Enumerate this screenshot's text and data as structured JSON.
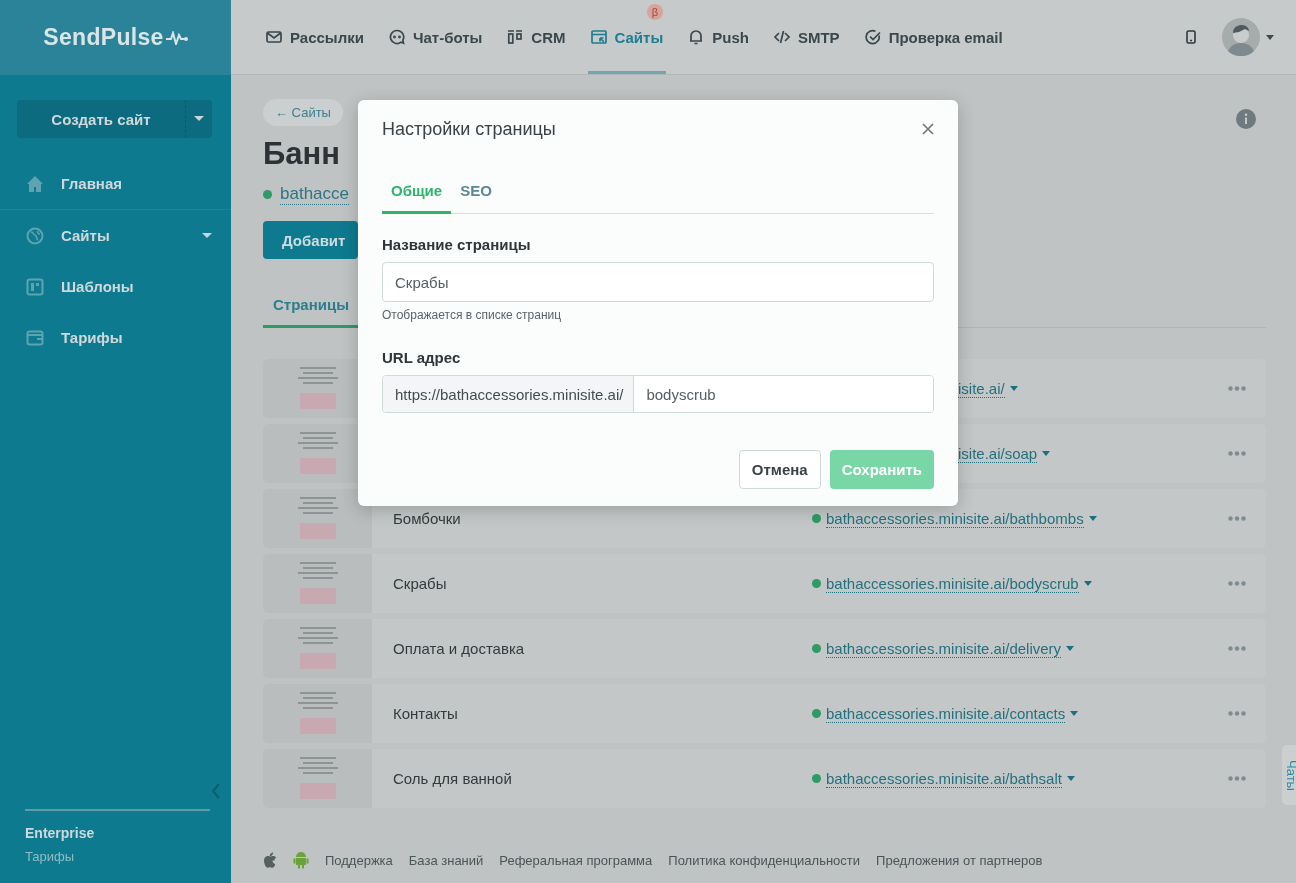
{
  "logo": {
    "text": "SendPulse"
  },
  "nav": [
    {
      "label": "Рассылки",
      "selected": false
    },
    {
      "label": "Чат-боты",
      "selected": false
    },
    {
      "label": "CRM",
      "selected": false
    },
    {
      "label": "Сайты",
      "selected": true,
      "badge": "β"
    },
    {
      "label": "Push",
      "selected": false
    },
    {
      "label": "SMTP",
      "selected": false
    },
    {
      "label": "Проверка email",
      "selected": false
    }
  ],
  "sidebar": {
    "create_button": "Создать сайт",
    "items": [
      {
        "label": "Главная",
        "submenu": false
      },
      {
        "label": "Сайты",
        "submenu": true
      },
      {
        "label": "Шаблоны",
        "submenu": false
      },
      {
        "label": "Тарифы",
        "submenu": false
      }
    ],
    "plan": {
      "name": "Enterprise",
      "link": "Тарифы"
    }
  },
  "page": {
    "back_link": "← Сайты",
    "title": "Банн",
    "site_link": "bathacce",
    "add_button": "Добавит",
    "tabs": [
      {
        "label": "Страницы",
        "selected": true
      }
    ],
    "rows": [
      {
        "kind": "covered",
        "url": "isite.ai/"
      },
      {
        "kind": "covered",
        "url": "isite.ai/soap"
      },
      {
        "kind": "full",
        "name": "Бомбочки",
        "url": "bathaccessories.minisite.ai/bathbombs"
      },
      {
        "kind": "full",
        "name": "Скрабы",
        "url": "bathaccessories.minisite.ai/bodyscrub"
      },
      {
        "kind": "full",
        "name": "Оплата и доставка",
        "url": "bathaccessories.minisite.ai/delivery"
      },
      {
        "kind": "full",
        "name": "Контакты",
        "url": "bathaccessories.minisite.ai/contacts"
      },
      {
        "kind": "full",
        "name": "Соль для ванной",
        "url": "bathaccessories.minisite.ai/bathsalt"
      }
    ]
  },
  "footer": {
    "links": [
      "Поддержка",
      "База знаний",
      "Реферальная программа",
      "Политика конфиденциальности",
      "Предложения от партнеров"
    ]
  },
  "chat_tab": "Чаты",
  "modal": {
    "title": "Настройки страницы",
    "tabs": [
      {
        "label": "Общие",
        "selected": true
      },
      {
        "label": "SEO",
        "selected": false
      }
    ],
    "name_field": {
      "label": "Название страницы",
      "value": "Скрабы",
      "hint": "Отображается в списке страниц"
    },
    "url_field": {
      "label": "URL адрес",
      "prefix": "https://bathaccessories.minisite.ai/",
      "value": "bodyscrub"
    },
    "cancel_button": "Отмена",
    "save_button": {
      "label": "Сохранить",
      "disabled": true
    }
  }
}
